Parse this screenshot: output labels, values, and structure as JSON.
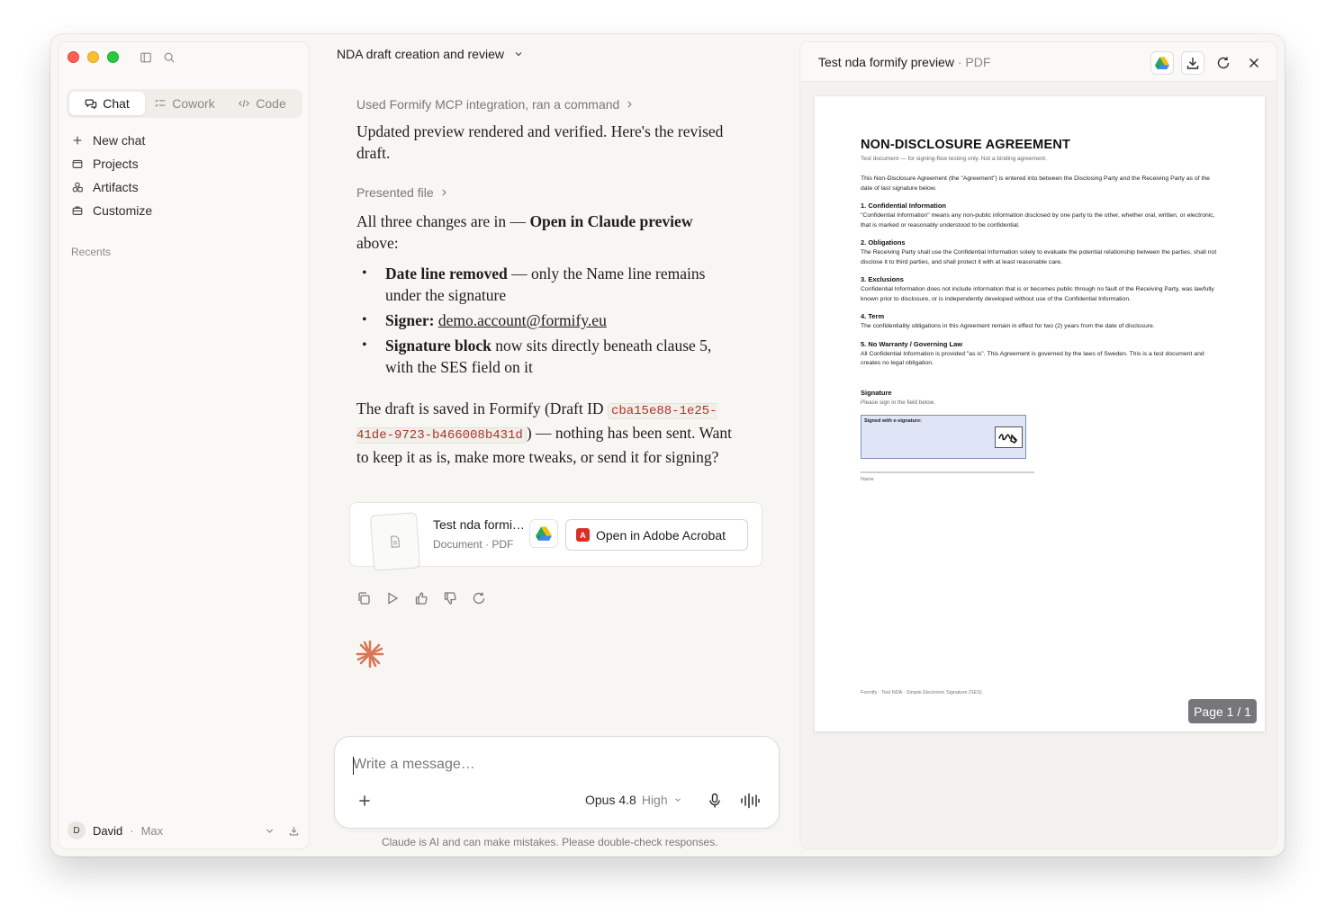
{
  "sidebar": {
    "tabs": [
      {
        "label": "Chat"
      },
      {
        "label": "Cowork"
      },
      {
        "label": "Code"
      }
    ],
    "nav": [
      {
        "label": "New chat"
      },
      {
        "label": "Projects"
      },
      {
        "label": "Artifacts"
      },
      {
        "label": "Customize"
      }
    ],
    "recents_label": "Recents",
    "user": {
      "initial": "D",
      "name": "David",
      "separator": "·",
      "plan": "Max"
    }
  },
  "chat": {
    "title": "NDA draft creation and review",
    "tool_line": "Used Formify MCP integration, ran a command",
    "p1": "Updated preview rendered and verified. Here's the revised draft.",
    "presented": "Presented file",
    "p2_a": "All three changes are in — ",
    "p2_b": "Open in Claude preview",
    "p2_c": " above:",
    "bullets": [
      {
        "bold": "Date line removed",
        "text": " — only the Name line remains under the signature"
      },
      {
        "bold": "Signer:",
        "link": "demo.account@formify.eu"
      },
      {
        "bold": "Signature block",
        "text": " now sits directly beneath clause 5, with the SES field on it"
      }
    ],
    "p3_a": "The draft is saved in Formify (Draft ID ",
    "draft_id": "cba15e88-1e25-41de-9723-b466008b431d",
    "p3_b": ") — nothing has been sent. Want to keep it as is, make more tweaks, or send it for signing?",
    "file": {
      "name": "Test nda formi…",
      "meta": "Document · PDF",
      "acrobat_label": "Open in Adobe Acrobat"
    }
  },
  "composer": {
    "placeholder": "Write a message…",
    "model": "Opus 4.8",
    "effort": "High"
  },
  "disclaimer": "Claude is AI and can make mistakes. Please double-check responses.",
  "preview": {
    "title": "Test nda formify preview",
    "sep": " · ",
    "type": "PDF",
    "doc": {
      "title": "NON-DISCLOSURE AGREEMENT",
      "subtitle": "Test document — for signing-flow testing only. Not a binding agreement.",
      "intro": "This Non-Disclosure Agreement (the \"Agreement\") is entered into between the Disclosing Party and the Receiving Party as of the date of last signature below.",
      "sections": [
        {
          "heading": "1. Confidential Information",
          "text": "\"Confidential Information\" means any non-public information disclosed by one party to the other, whether oral, written, or electronic, that is marked or reasonably understood to be confidential."
        },
        {
          "heading": "2. Obligations",
          "text": "The Receiving Party shall use the Confidential Information solely to evaluate the potential relationship between the parties, shall not disclose it to third parties, and shall protect it with at least reasonable care."
        },
        {
          "heading": "3. Exclusions",
          "text": "Confidential Information does not include information that is or becomes public through no fault of the Receiving Party, was lawfully known prior to disclosure, or is independently developed without use of the Confidential Information."
        },
        {
          "heading": "4. Term",
          "text": "The confidentiality obligations in this Agreement remain in effect for two (2) years from the date of disclosure."
        },
        {
          "heading": "5. No Warranty / Governing Law",
          "text": "All Confidential Information is provided \"as is\". This Agreement is governed by the laws of Sweden. This is a test document and creates no legal obligation."
        }
      ],
      "signature_heading": "Signature",
      "signature_hint": "Please sign in the field below.",
      "signature_field_label": "Signed with e-signature:",
      "name_label": "Name",
      "footer": "Formify · Test NDA · Simple Electronic Signature (SES)"
    },
    "page_indicator": "Page 1 / 1"
  },
  "colors": {
    "accent_spark": "#d97757",
    "code_text": "#b1332b",
    "acrobat_red": "#d93025"
  }
}
